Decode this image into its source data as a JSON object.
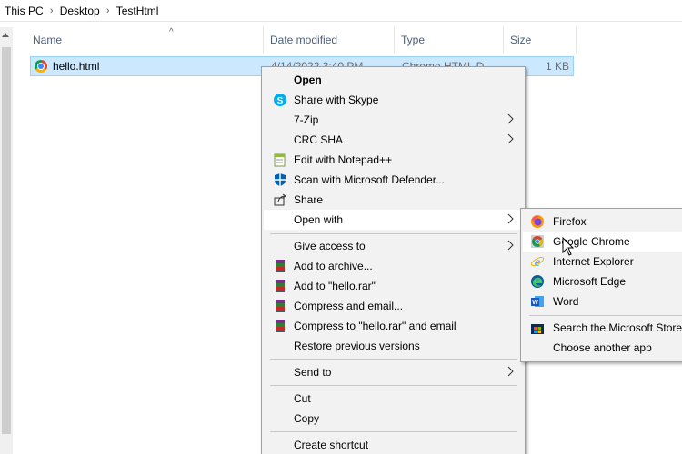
{
  "breadcrumb": {
    "items": [
      "This PC",
      "Desktop",
      "TestHtml"
    ]
  },
  "columns": {
    "name": "Name",
    "date": "Date modified",
    "type": "Type",
    "size": "Size"
  },
  "file": {
    "name": "hello.html",
    "date": "4/14/2022 3:40 PM",
    "type": "Chrome HTML D...",
    "size": "1 KB"
  },
  "context_menu": {
    "open": "Open",
    "share_skype": "Share with Skype",
    "zip": "7-Zip",
    "crc": "CRC SHA",
    "notepad": "Edit with Notepad++",
    "defender": "Scan with Microsoft Defender...",
    "share": "Share",
    "open_with": "Open with",
    "give_access": "Give access to",
    "add_archive": "Add to archive...",
    "add_rar": "Add to \"hello.rar\"",
    "compress_email": "Compress and email...",
    "compress_rar_email": "Compress to \"hello.rar\" and email",
    "restore": "Restore previous versions",
    "send_to": "Send to",
    "cut": "Cut",
    "copy": "Copy",
    "create_shortcut": "Create shortcut"
  },
  "open_with_menu": {
    "firefox": "Firefox",
    "chrome": "Google Chrome",
    "ie": "Internet Explorer",
    "edge": "Microsoft Edge",
    "word": "Word",
    "store": "Search the Microsoft Store",
    "another": "Choose another app"
  },
  "colors": {
    "selection": "#cce8ff",
    "selection_border": "#99d1ff",
    "menu_bg": "#f2f2f2",
    "menu_highlight": "#ffffff",
    "header_text": "#4c607a"
  }
}
